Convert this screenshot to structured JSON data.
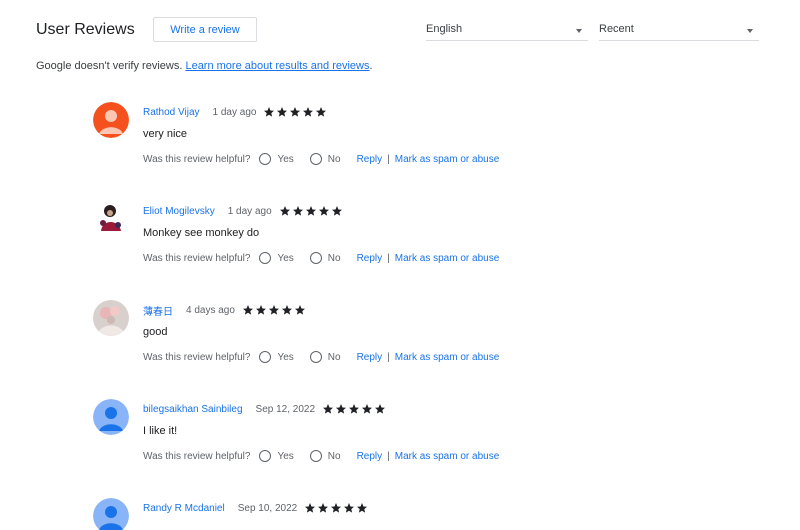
{
  "header": {
    "title": "User Reviews",
    "write_review_label": "Write a review",
    "language_value": "English",
    "sort_value": "Recent"
  },
  "disclaimer": {
    "text": "Google doesn't verify reviews. ",
    "link_text": "Learn more about results and reviews",
    "tail": "."
  },
  "helpful_prompt": "Was this review helpful?",
  "yes_label": "Yes",
  "no_label": "No",
  "reply_label": "Reply",
  "separator": "|",
  "spam_label": "Mark as spam or abuse",
  "colors": {
    "link": "#1a73e8",
    "star": "#202124",
    "avatar_default": "#8ab4f8"
  },
  "reviews": [
    {
      "author": "Rathod Vijay",
      "date": "1 day ago",
      "rating": 5,
      "text": "very nice",
      "avatar": "orange-person-avatar"
    },
    {
      "author": "Eliot Mogilevsky",
      "date": "1 day ago",
      "rating": 5,
      "text": "Monkey see monkey do",
      "avatar": "monkey-photo-avatar"
    },
    {
      "author": "薄春日",
      "date": "4 days ago",
      "rating": 5,
      "text": "good",
      "avatar": "photo-avatar"
    },
    {
      "author": "bilegsaikhan Sainbileg",
      "date": "Sep 12, 2022",
      "rating": 5,
      "text": "I like it!",
      "avatar": "blue-person-avatar"
    },
    {
      "author": "Randy R Mcdaniel",
      "date": "Sep 10, 2022",
      "rating": 5,
      "text": "",
      "avatar": "blue-person-avatar"
    }
  ]
}
